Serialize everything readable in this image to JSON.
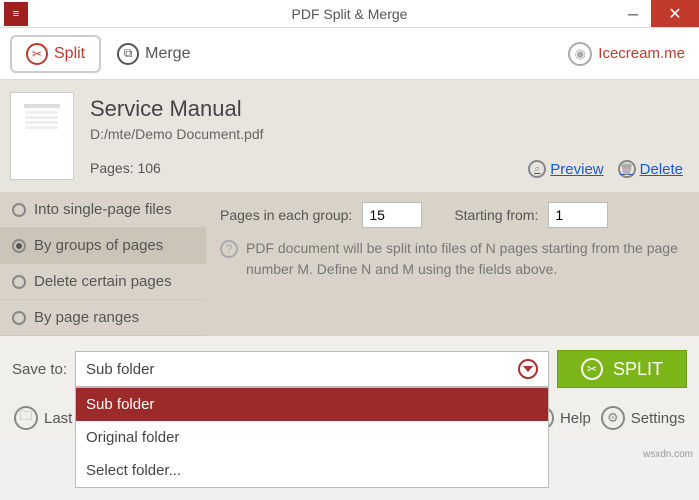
{
  "window": {
    "title": "PDF Split & Merge"
  },
  "tabs": {
    "split": "Split",
    "merge": "Merge"
  },
  "brand": {
    "label": "Icecream.me"
  },
  "document": {
    "title": "Service Manual",
    "path": "D:/mte/Demo Document.pdf",
    "pages_label": "Pages: 106"
  },
  "actions": {
    "preview": "Preview",
    "delete": "Delete"
  },
  "split_modes": {
    "single": "Into single-page files",
    "groups": "By groups of pages",
    "delete": "Delete certain pages",
    "ranges": "By page ranges"
  },
  "params": {
    "pages_each_label": "Pages in each group:",
    "pages_each_value": "15",
    "start_label": "Starting from:",
    "start_value": "1",
    "info": "PDF document will be split into files of N pages starting from the page number M. Define N and M using the fields above."
  },
  "save": {
    "label": "Save to:",
    "selected": "Sub folder",
    "options": {
      "sub": "Sub folder",
      "orig": "Original folder",
      "select": "Select folder..."
    }
  },
  "split_button": "SPLIT",
  "footer": {
    "last": "Last",
    "help": "Help",
    "settings": "Settings"
  },
  "watermark": "wsxdn.com"
}
